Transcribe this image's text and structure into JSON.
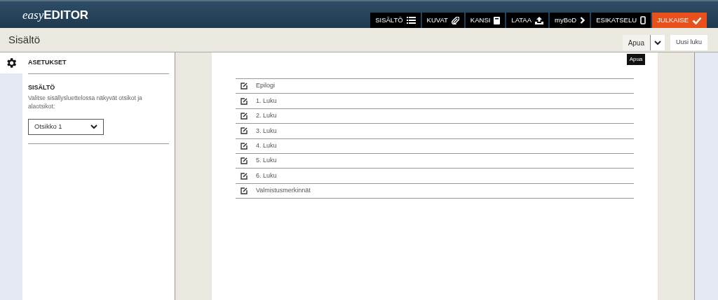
{
  "app": {
    "logo_light": "easy",
    "logo_bold": "EDITOR"
  },
  "nav": [
    {
      "label": "SISÄLTÖ",
      "kind": "plain"
    },
    {
      "label": "KUVAT",
      "kind": "plain"
    },
    {
      "label": "KANSI",
      "kind": "plain"
    },
    {
      "label": "LATAA",
      "kind": "plain"
    },
    {
      "label": "myBoD",
      "kind": "plain"
    },
    {
      "label": "ESIKATSELU",
      "kind": "plain"
    },
    {
      "label": "JULKAISE",
      "kind": "primary"
    }
  ],
  "toolbar": {
    "title": "Sisältö",
    "help_button": "Apua",
    "tooltip": "Apua",
    "new_button": "Uusi luku"
  },
  "sidebar": {
    "heading": "ASETUKSET",
    "section_title": "SISÄLTÖ",
    "description": "Valitse sisällysluettelossa näkyvät otsikot ja alaotsikot:",
    "select_value": "Otsikko 1"
  },
  "chapters": [
    "Epilogi",
    "1. Luku",
    "2. Luku",
    "3. Luku",
    "4. Luku",
    "5. Luku",
    "6. Luku",
    "Valmistusmerkinnät"
  ]
}
